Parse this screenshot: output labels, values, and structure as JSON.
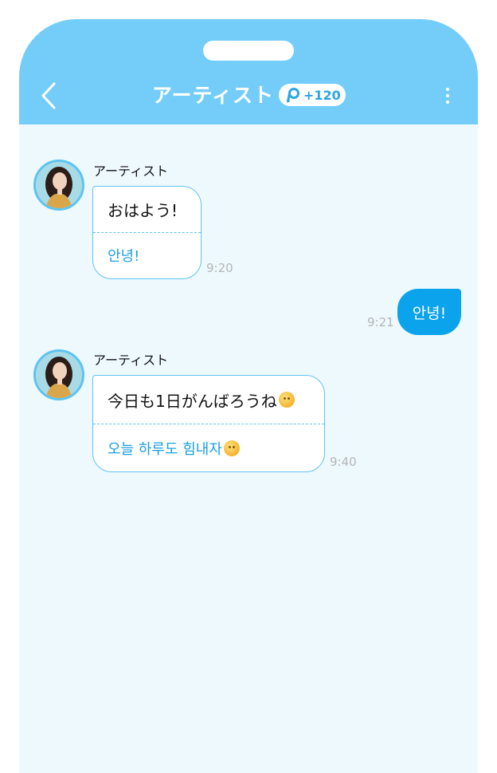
{
  "header": {
    "title": "アーティスト",
    "points_badge": "+120",
    "back_icon": "chevron-left-icon",
    "menu_icon": "more-vertical-icon",
    "colors": {
      "header_bg": "#74cdf9",
      "chat_bg": "#eef9fe",
      "accent": "#0aa3ec"
    }
  },
  "messages": [
    {
      "sender": "アーティスト",
      "text_jp": "おはよう!",
      "text_ko": "안녕!",
      "time": "9:20"
    },
    {
      "text": "안녕!",
      "time": "9:21"
    },
    {
      "sender": "アーティスト",
      "text_jp": "今日も1日がんばろうね",
      "text_ko": "오늘 하루도 힘내자",
      "emoji": "smiling-sun-emoji",
      "time": "9:40"
    }
  ]
}
